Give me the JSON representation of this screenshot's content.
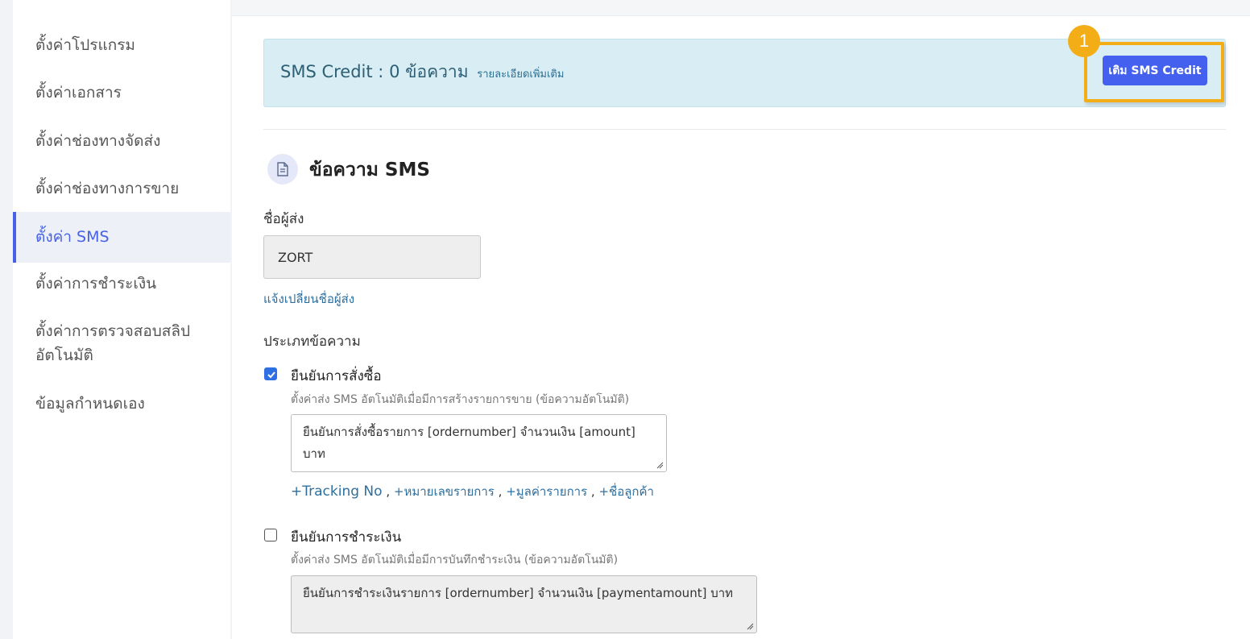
{
  "sidebar": {
    "items": [
      {
        "label": "ตั้งค่าโปรแกรม"
      },
      {
        "label": "ตั้งค่าเอกสาร"
      },
      {
        "label": "ตั้งค่าช่องทางจัดส่ง"
      },
      {
        "label": "ตั้งค่าช่องทางการขาย"
      },
      {
        "label": "ตั้งค่า SMS",
        "active": true
      },
      {
        "label": "ตั้งค่าการชำระเงิน"
      },
      {
        "label": "ตั้งค่าการตรวจสอบสลิป"
      },
      {
        "label": "ข้อมูลกำหนดเอง"
      }
    ],
    "item_6_line2": "อัตโนมัติ"
  },
  "credit": {
    "label": "SMS Credit",
    "separator": ":",
    "count": "0 ข้อความ",
    "more_link": "รายละเอียดเพิ่มเติม",
    "topup_button": "เติม SMS Credit",
    "step_badge": "1"
  },
  "section": {
    "title": "ข้อความ SMS",
    "icon": "document-icon"
  },
  "sender": {
    "label": "ชื่อผู้ส่ง",
    "value": "ZORT",
    "change_link": "แจ้งเปลี่ยนชื่อผู้ส่ง"
  },
  "message_types": {
    "label": "ประเภทข้อความ",
    "options": [
      {
        "title": "ยืนยันการสั่งซื้อ",
        "checked": true,
        "description": "ตั้งค่าส่ง SMS อัตโนมัติเมื่อมีการสร้างรายการขาย (ข้อความอัตโนมัติ)",
        "message": "ยืนยันการสั่งซื้อรายการ [ordernumber] จำนวนเงิน [amount] บาท",
        "tags": [
          "+Tracking No",
          "+หมายเลขรายการ",
          "+มูลค่ารายการ",
          "+ชื่อลูกค้า"
        ],
        "tag_separator": ","
      },
      {
        "title": "ยืนยันการชำระเงิน",
        "checked": false,
        "description": "ตั้งค่าส่ง SMS อัตโนมัติเมื่อมีการบันทึกชำระเงิน (ข้อความอัตโนมัติ)",
        "message": "ยืนยันการชำระเงินรายการ [ordernumber] จำนวนเงิน [paymentamount] บาท"
      }
    ]
  },
  "colors": {
    "accent": "#4361ee",
    "highlight": "#f3ad16",
    "info_bg": "#d8edf4"
  }
}
